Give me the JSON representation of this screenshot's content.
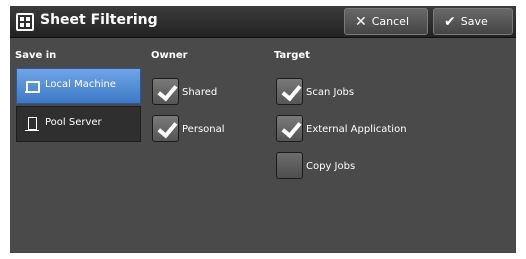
{
  "header": {
    "title": "Sheet Filtering",
    "cancel_label": "Cancel",
    "save_label": "Save"
  },
  "save_in": {
    "label": "Save in",
    "options": [
      {
        "label": "Local Machine",
        "selected": true
      },
      {
        "label": "Pool Server",
        "selected": false
      }
    ]
  },
  "owner": {
    "label": "Owner",
    "options": [
      {
        "label": "Shared",
        "checked": true
      },
      {
        "label": "Personal",
        "checked": true
      }
    ]
  },
  "target": {
    "label": "Target",
    "options": [
      {
        "label": "Scan Jobs",
        "checked": true
      },
      {
        "label": "External Application",
        "checked": true
      },
      {
        "label": "Copy Jobs",
        "checked": false
      }
    ]
  },
  "colors": {
    "selected_blue": "#4a86d6",
    "panel_gray": "#4a4a4a",
    "header_dark": "#2a2a2a"
  }
}
